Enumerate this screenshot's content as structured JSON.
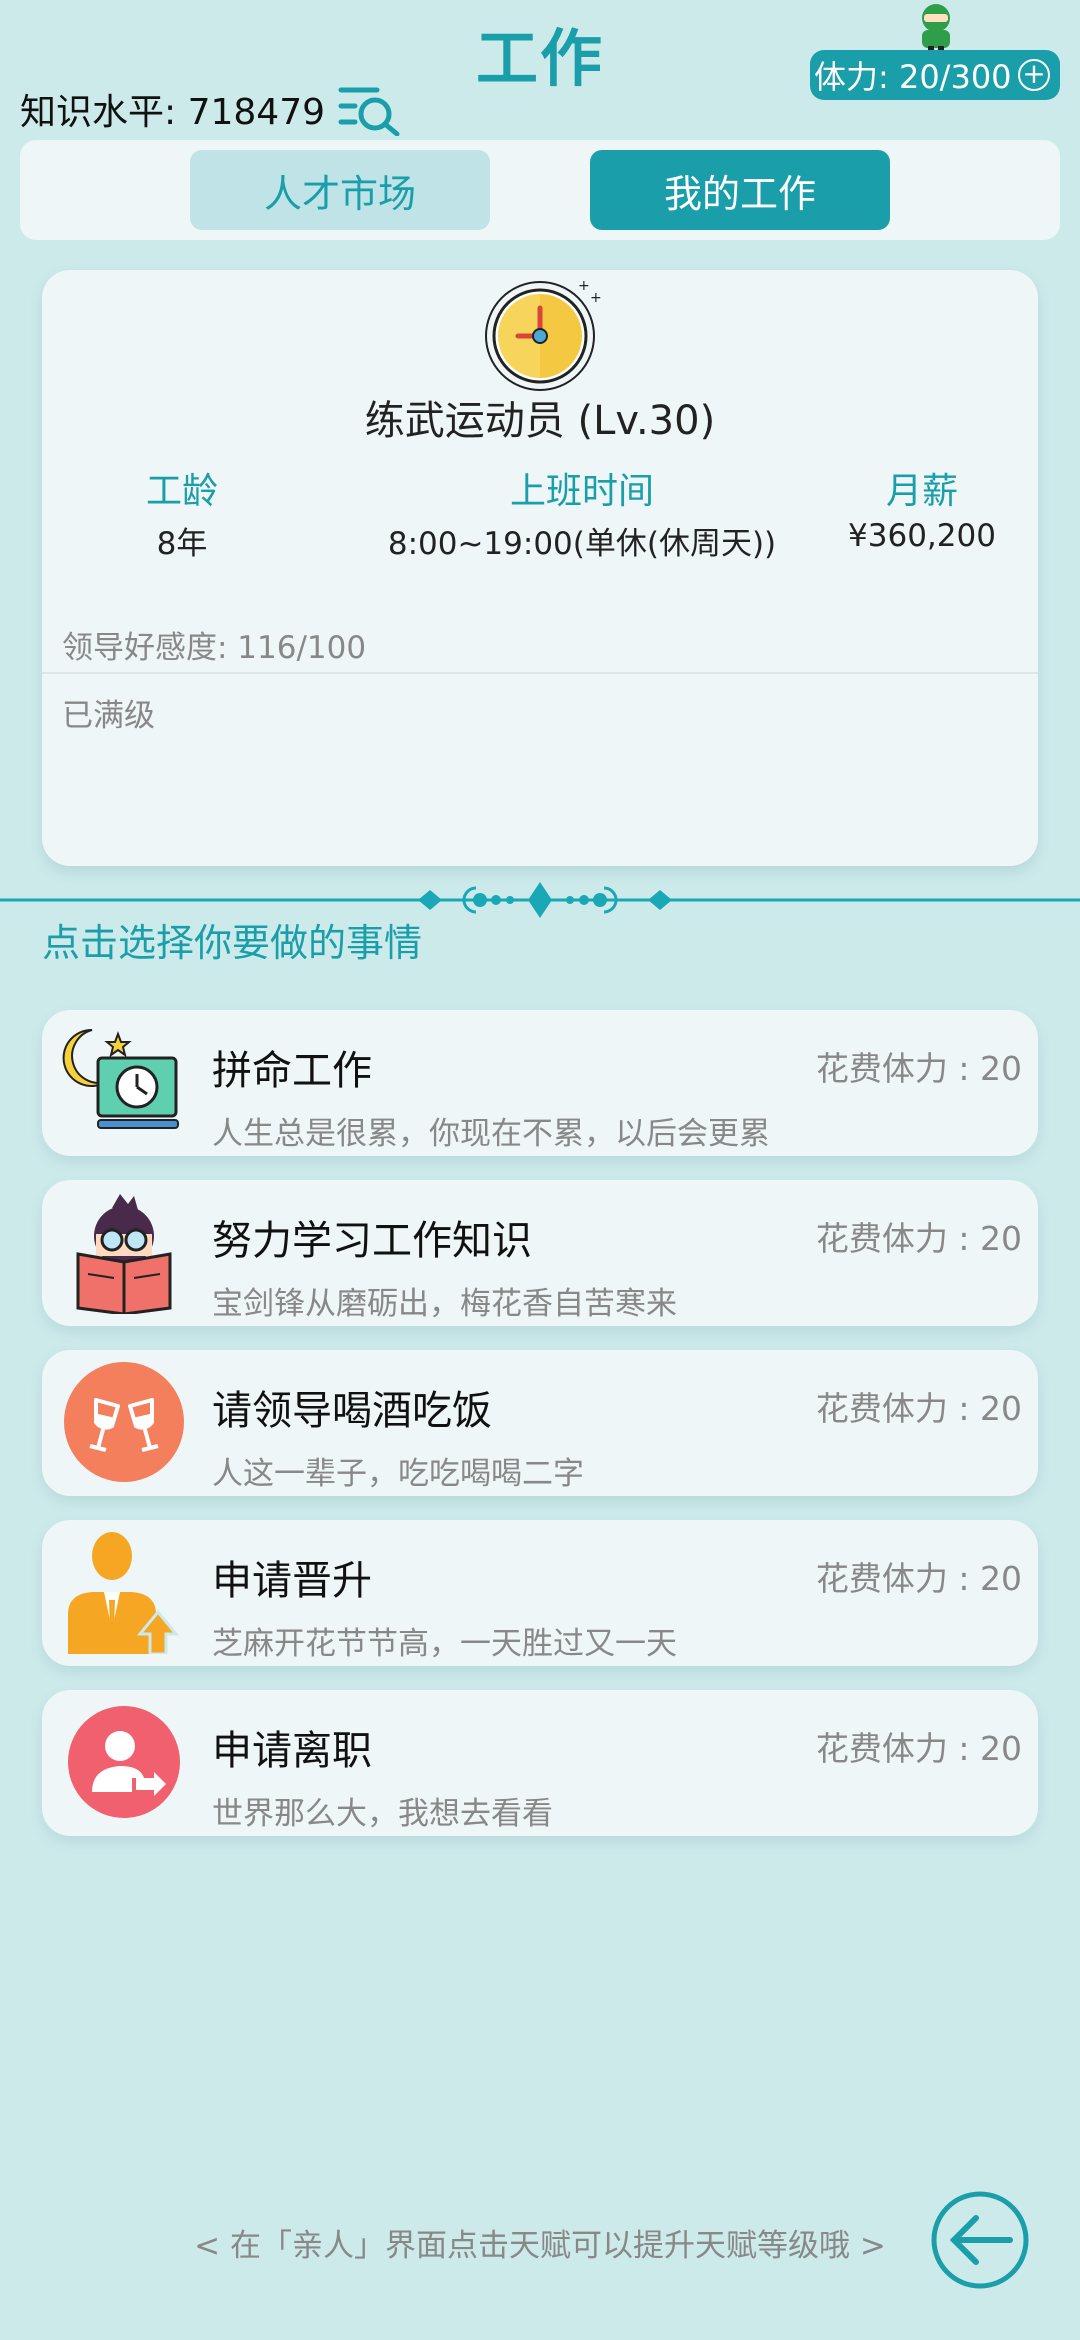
{
  "header": {
    "title": "工作",
    "knowledge_label": "知识水平: 718479",
    "stamina_label": "体力: 20/300"
  },
  "tabs": [
    {
      "label": "人才市场",
      "active": false
    },
    {
      "label": "我的工作",
      "active": true
    }
  ],
  "job": {
    "name": "练武运动员 (Lv.30)",
    "stats": [
      {
        "label": "工龄",
        "value": "8年"
      },
      {
        "label": "上班时间",
        "value": "8:00~19:00(单休(休周天))"
      },
      {
        "label": "月薪",
        "value": "¥360,200"
      }
    ],
    "favor": "领导好感度: 116/100",
    "status": "已满级"
  },
  "section_title": "点击选择你要做的事情",
  "actions": [
    {
      "name": "拼命工作",
      "cost": "花费体力 : 20",
      "desc": "人生总是很累，你现在不累，以后会更累",
      "icon": "moon-laptop-icon"
    },
    {
      "name": "努力学习工作知识",
      "cost": "花费体力 : 20",
      "desc": "宝剑锋从磨砺出，梅花香自苦寒来",
      "icon": "reading-book-icon"
    },
    {
      "name": "请领导喝酒吃饭",
      "cost": "花费体力 : 20",
      "desc": "人这一辈子，吃吃喝喝二字",
      "icon": "wine-glasses-icon"
    },
    {
      "name": "申请晋升",
      "cost": "花费体力 : 20",
      "desc": "芝麻开花节节高，一天胜过又一天",
      "icon": "promotion-person-icon"
    },
    {
      "name": "申请离职",
      "cost": "花费体力 : 20",
      "desc": "世界那么大，我想去看看",
      "icon": "resign-person-icon"
    }
  ],
  "tip": "< 在「亲人」界面点击天赋可以提升天赋等级哦 >",
  "colors": {
    "accent": "#1a9eaa",
    "background": "#cdeaeb",
    "card": "#eef6f7",
    "muted_text": "#888888"
  }
}
